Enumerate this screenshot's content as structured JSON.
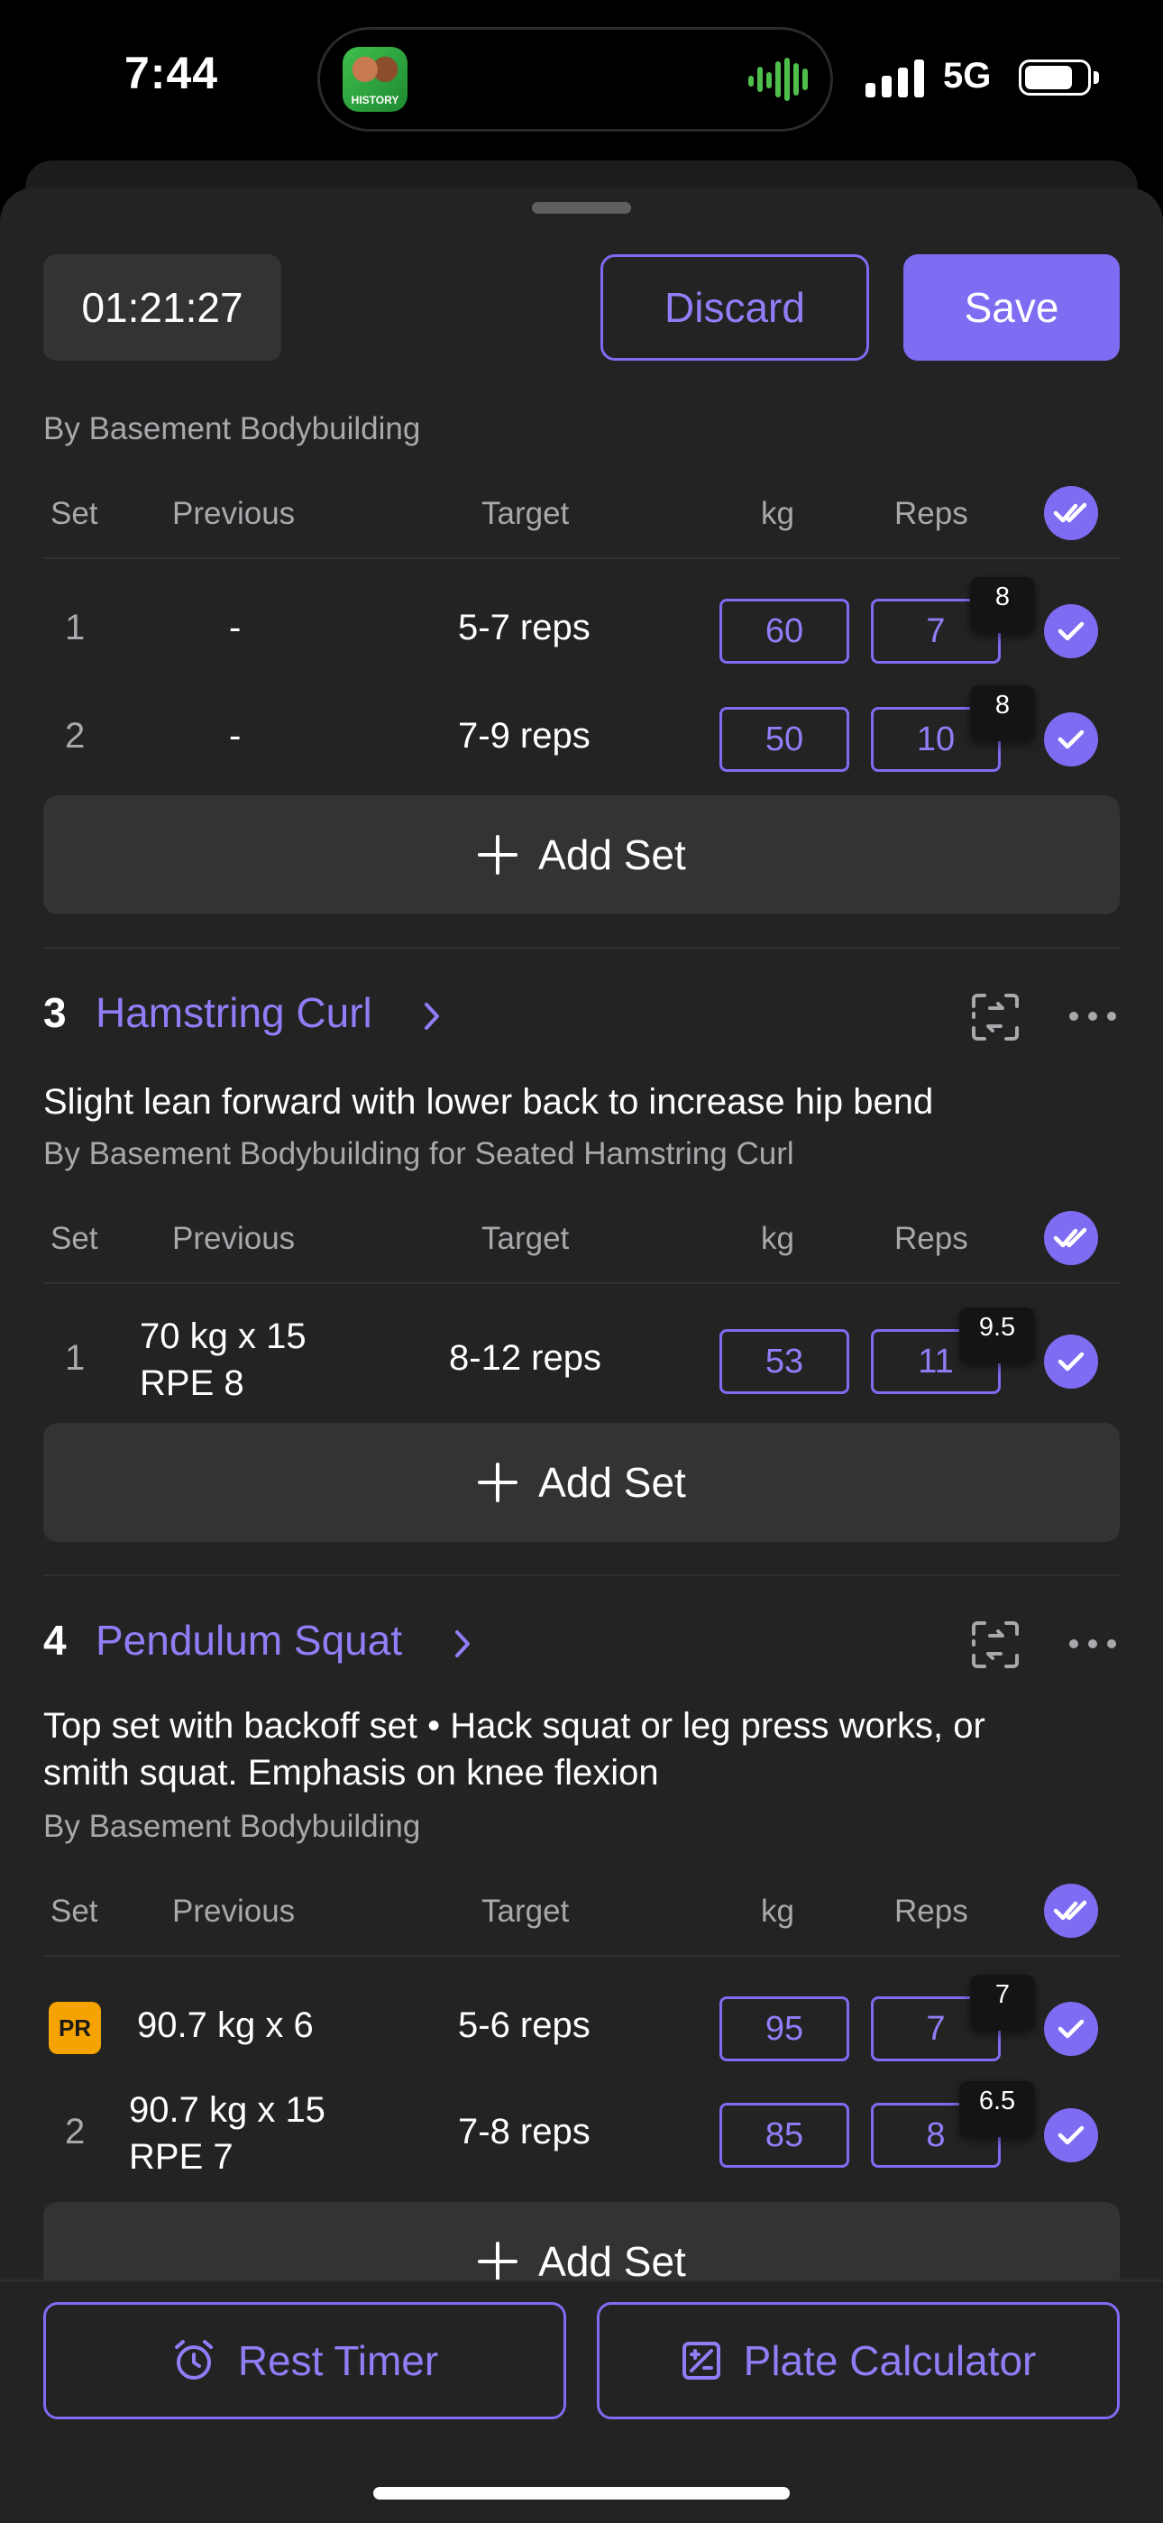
{
  "status_bar": {
    "time": "7:44",
    "network": "5G",
    "live_activity_app": "HISTORY"
  },
  "header": {
    "timer": "01:21:27",
    "discard_label": "Discard",
    "save_label": "Save"
  },
  "columns": {
    "set": "Set",
    "previous": "Previous",
    "target": "Target",
    "kg": "kg",
    "reps": "Reps"
  },
  "exercise2": {
    "author": "By Basement Bodybuilding",
    "sets": [
      {
        "set": "1",
        "previous": "-",
        "target": "5-7 reps",
        "kg": "60",
        "reps": "7",
        "rpe": "8"
      },
      {
        "set": "2",
        "previous": "-",
        "target": "7-9 reps",
        "kg": "50",
        "reps": "10",
        "rpe": "8"
      }
    ],
    "add_set_label": "Add Set"
  },
  "exercise3": {
    "number": "3",
    "name": "Hamstring Curl",
    "note": "Slight lean forward with lower back to increase hip bend",
    "author": "By Basement Bodybuilding for Seated Hamstring Curl",
    "sets": [
      {
        "set": "1",
        "previous_line1": "70 kg x 15",
        "previous_line2": "RPE 8",
        "target": "8-12 reps",
        "kg": "53",
        "reps": "11",
        "rpe": "9.5"
      }
    ],
    "add_set_label": "Add Set"
  },
  "exercise4": {
    "number": "4",
    "name": "Pendulum Squat",
    "note_line1": "Top set with backoff set • Hack squat or leg press works, or",
    "note_line2": "smith squat. Emphasis on knee flexion",
    "author": "By Basement Bodybuilding",
    "sets": [
      {
        "set": "PR",
        "previous": "90.7 kg x 6",
        "target": "5-6 reps",
        "kg": "95",
        "reps": "7",
        "rpe": "7"
      },
      {
        "set": "2",
        "previous_line1": "90.7 kg x 15",
        "previous_line2": "RPE 7",
        "target": "7-8 reps",
        "kg": "85",
        "reps": "8",
        "rpe": "6.5"
      }
    ],
    "add_set_label": "Add Set"
  },
  "bottom": {
    "rest_timer_label": "Rest Timer",
    "plate_calculator_label": "Plate Calculator"
  },
  "colors": {
    "accent": "#7e6cf2",
    "accent_text": "#8f7ff7",
    "pr_badge": "#f5a300",
    "sheet_bg": "#232323",
    "button_bg": "#333335"
  }
}
